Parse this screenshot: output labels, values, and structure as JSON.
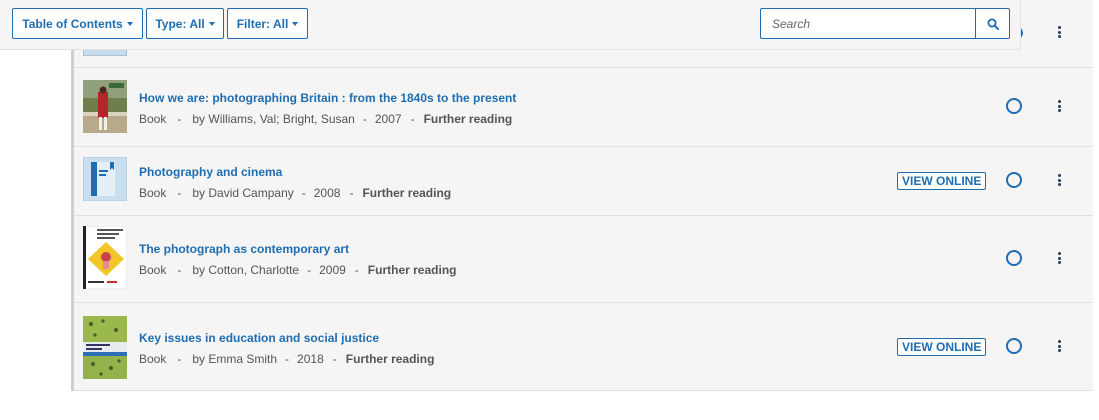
{
  "toolbar": {
    "toc_label": "Table of Contents",
    "type_label": "Type: All",
    "filter_label": "Filter: All",
    "search_placeholder": "Search"
  },
  "items": [
    {
      "title": "How we are: photographing Britain : from the 1840s to the present",
      "type": "Book",
      "authors": "by Williams, Val; Bright, Susan",
      "year": "2007",
      "category": "Further reading",
      "view_online": null,
      "thumb_icon": "book-cover-how-we-are"
    },
    {
      "title": "Photography and cinema",
      "type": "Book",
      "authors": "by David Campany",
      "year": "2008",
      "category": "Further reading",
      "view_online": "VIEW ONLINE",
      "thumb_icon": "generic-book-icon"
    },
    {
      "title": "The photograph as contemporary art",
      "type": "Book",
      "authors": "by Cotton, Charlotte",
      "year": "2009",
      "category": "Further reading",
      "view_online": null,
      "thumb_icon": "book-cover-photograph-contemporary-art"
    },
    {
      "title": "Key issues in education and social justice",
      "type": "Book",
      "authors": "by Emma Smith",
      "year": "2018",
      "category": "Further reading",
      "view_online": "VIEW ONLINE",
      "thumb_icon": "book-cover-key-issues"
    }
  ],
  "colors": {
    "accent": "#1f6db1",
    "panel_bg": "#f5f5f5",
    "kebab": "#1f3f66"
  }
}
